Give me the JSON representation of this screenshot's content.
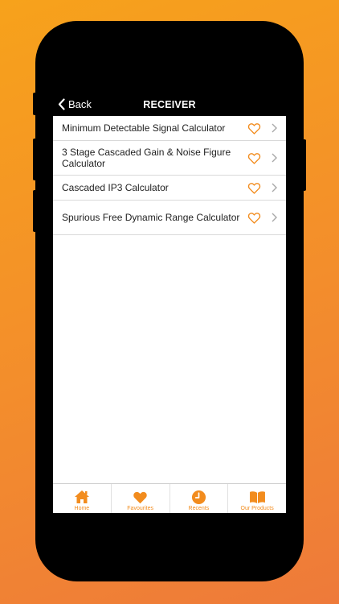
{
  "navbar": {
    "back_label": "Back",
    "title": "RECEIVER"
  },
  "calculators": [
    {
      "label": "Minimum Detectable Signal Calculator",
      "favourite": false
    },
    {
      "label": "3 Stage Cascaded Gain & Noise Figure Calculator",
      "favourite": false
    },
    {
      "label": "Cascaded IP3 Calculator",
      "favourite": false
    },
    {
      "label": "Spurious Free Dynamic Range Calculator",
      "favourite": false
    }
  ],
  "tabbar": {
    "home": "Home",
    "favourites": "Favourites",
    "recents": "Recents",
    "products": "Our Products"
  },
  "colors": {
    "accent": "#f28c1e",
    "background_top": "#f7a21b",
    "background_bottom": "#ee7a3a"
  },
  "icons": {
    "back": "chevron-left-icon",
    "favourite": "heart-outline-icon",
    "disclosure": "chevron-right-icon",
    "home": "home-icon",
    "favourites": "heart-icon",
    "recents": "clock-icon",
    "products": "book-icon"
  }
}
